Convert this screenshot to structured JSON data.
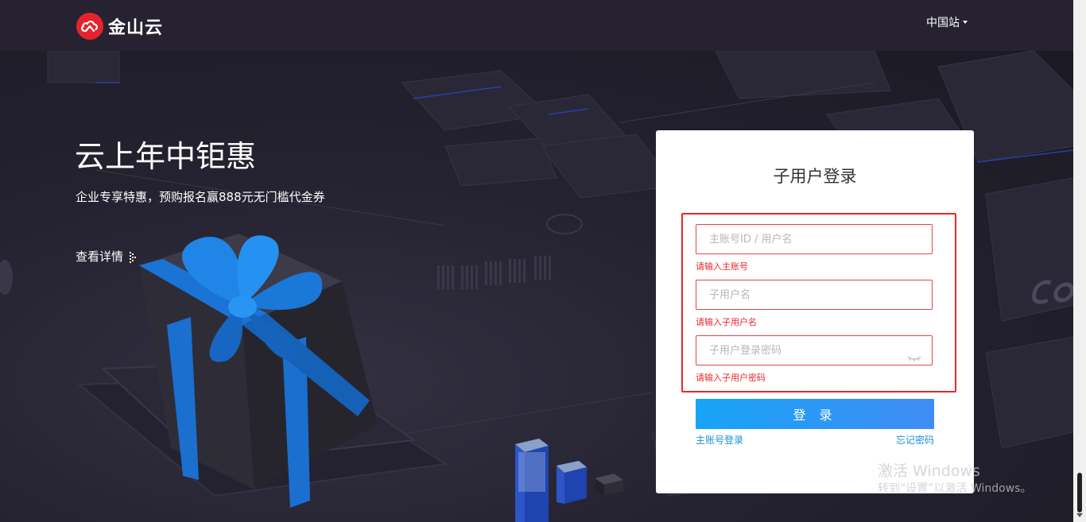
{
  "header": {
    "brand": "金山云",
    "region": "中国站"
  },
  "promo": {
    "title": "云上年中钜惠",
    "subtitle": "企业专享特惠，预购报名赢888元无门槛代金券",
    "link": "查看详情"
  },
  "login": {
    "title": "子用户登录",
    "main_account": {
      "placeholder": "主账号ID / 用户名",
      "value": "",
      "error": "请输入主账号"
    },
    "sub_user": {
      "placeholder": "子用户名",
      "value": "",
      "error": "请输入子用户名"
    },
    "password": {
      "placeholder": "子用户登录密码",
      "value": "",
      "error": "请输入子用户密码"
    },
    "submit_label": "登 录",
    "main_login_link": "主账号登录",
    "forgot_link": "忘记密码"
  },
  "windows_watermark": {
    "line1": "激活 Windows",
    "line2": "转到“设置”以激活 Windows。"
  },
  "colors": {
    "header_bg": "#262232",
    "brand_red": "#e6232d",
    "error_red": "#e8282b",
    "button_blue": "#18a4f6",
    "link_blue": "#1a90d8"
  }
}
